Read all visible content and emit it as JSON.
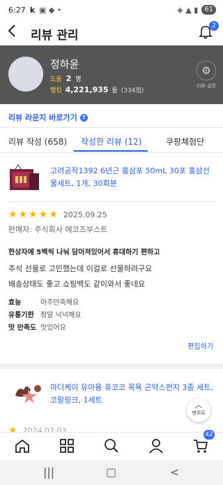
{
  "status_bar": {
    "time": "6:27",
    "indicators": "k",
    "battery": "61"
  },
  "topbar": {
    "back_label": "<",
    "title": "리뷰 관리",
    "notification_count": "2"
  },
  "profile": {
    "name": "정하윤",
    "helped_label": "도움",
    "helped_value": "2",
    "helped_unit": "명",
    "rank_label": "랭킹",
    "rank_value": "4,221,935",
    "rank_unit": "등",
    "rank_sub": "(334점)",
    "settings_label": "리뷰 설정"
  },
  "lounge_link": "리뷰 라운지 바로가기",
  "tabs": [
    {
      "label": "리뷰 작성 (658)"
    },
    {
      "label": "작성한 리뷰 (12)"
    },
    {
      "label": "쿠팡체험단"
    }
  ],
  "review1": {
    "product_title": "고려공작1392 6년근 홍삼포 50mL 30포 홍삼선물세트, 1개, 30회분",
    "rating": 5,
    "date": "2025.09.25",
    "seller": "판매자: 주식회사 에코즈부스트",
    "headline": "한상자에 5백씩 나눠 담아져있어서 휴대하기 편하고",
    "body_line1": "추석 선물로 고민했는데 이걸로 선물하려구요",
    "body_line2": "배송상태도 좋고 쇼핑백도 같이와서 좋네요",
    "attributes": [
      {
        "key": "효능",
        "value": "아주만족해요"
      },
      {
        "key": "유통기한",
        "value": "정말 넉넉해요"
      },
      {
        "key": "맛 만족도",
        "value": "맛있어요"
      }
    ],
    "edit_label": "편집하기"
  },
  "review2": {
    "product_title": "마더케이 유아용 퓨코코 목욕 곤약스펀지 3종 세트, 코랄핑크, 1세트",
    "rating": 1,
    "date": "2024.07.03"
  },
  "scroll_top_label": "맨위로",
  "bottom_nav": {
    "items": [
      "home",
      "category",
      "search",
      "my",
      "cart"
    ],
    "cart_count": "42"
  }
}
